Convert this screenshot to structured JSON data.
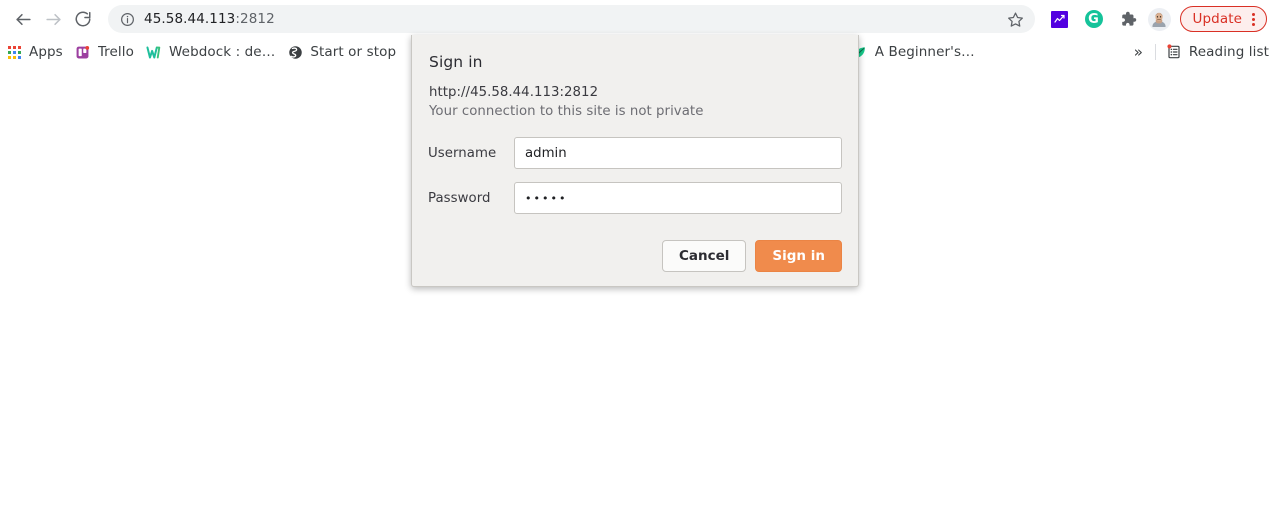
{
  "toolbar": {
    "back_label": "Back",
    "forward_label": "Forward",
    "reload_label": "Reload",
    "url": "45.58.44.113",
    "url_port": ":2812",
    "site_info_label": "Connection information",
    "bookmark_star_label": "Bookmark this tab",
    "extensions": [
      {
        "name": "analytics-extension",
        "label": "Analytics"
      },
      {
        "name": "grammarly-extension",
        "label": "G"
      },
      {
        "name": "extensions-puzzle",
        "label": "Extensions"
      }
    ],
    "avatar_label": "Profile",
    "update_label": "Update",
    "menu_label": "Customize and control Google Chrome"
  },
  "bookmarks": {
    "items": [
      {
        "label": "Apps",
        "icon": "apps-grid-icon"
      },
      {
        "label": "Trello",
        "icon": "trello-icon"
      },
      {
        "label": "Webdock : de…",
        "icon": "webdock-icon"
      },
      {
        "label": "Start or stop",
        "icon": "globe-icon"
      },
      {
        "label": "…",
        "icon": "generic-icon"
      },
      {
        "label": "A Beginner's…",
        "icon": "leaf-icon"
      }
    ],
    "overflow_label": "»",
    "reading_list_label": "Reading list"
  },
  "dialog": {
    "title": "Sign in",
    "url": "http://45.58.44.113:2812",
    "subtext": "Your connection to this site is not private",
    "username_label": "Username",
    "username_value": "admin",
    "username_placeholder": "",
    "password_label": "Password",
    "password_value": "•••••",
    "password_placeholder": "",
    "cancel_label": "Cancel",
    "submit_label": "Sign in"
  },
  "colors": {
    "accent_orange": "#f08b4c",
    "update_red": "#d93025",
    "dialog_bg": "#f1f0ee",
    "omnibox_bg": "#f1f3f4"
  }
}
